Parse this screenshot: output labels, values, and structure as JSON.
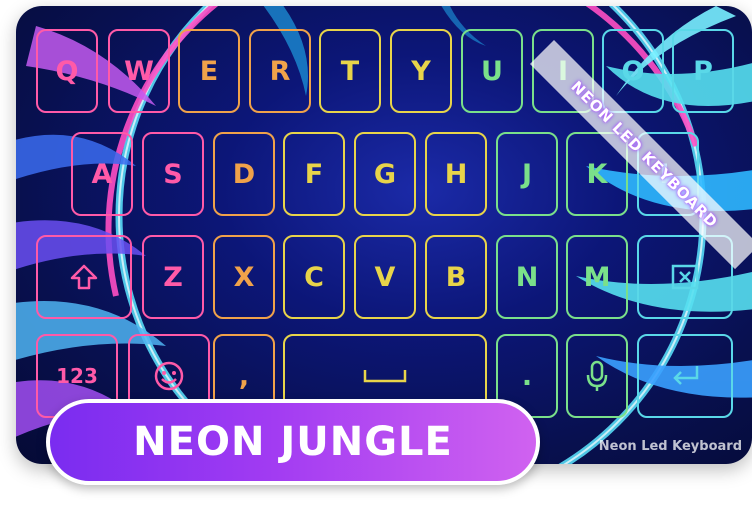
{
  "ribbon": {
    "label": "NEON LED KEYBOARD"
  },
  "watermark": {
    "label": "Neon Led Keyboard"
  },
  "badge": {
    "title": "NEON JUNGLE"
  },
  "keyboard": {
    "row1": [
      "Q",
      "W",
      "E",
      "R",
      "T",
      "Y",
      "U",
      "I",
      "O",
      "P"
    ],
    "row2": [
      "A",
      "S",
      "D",
      "F",
      "G",
      "H",
      "J",
      "K",
      "L"
    ],
    "row3": [
      "Z",
      "X",
      "C",
      "V",
      "B",
      "N",
      "M"
    ],
    "bottom": {
      "numbers_label": "123",
      "comma": ",",
      "period": "."
    },
    "icons": {
      "shift": "shift-icon",
      "delete": "backspace-icon",
      "emoji": "emoji-icon",
      "mic": "mic-icon",
      "space": "space-icon",
      "enter": "enter-icon"
    }
  },
  "colors": {
    "neon_pink": "#ff5aa8",
    "neon_cyan": "#5ad8e8",
    "neon_yellow": "#e8d44a",
    "badge_purple": "#a13bf2"
  }
}
